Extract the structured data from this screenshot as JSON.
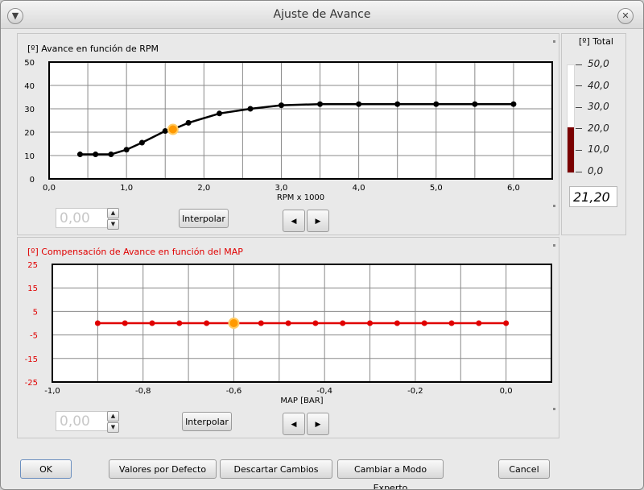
{
  "window": {
    "title": "Ajuste de Avance"
  },
  "rpm_panel": {
    "title": "[º] Avance en función de RPM",
    "input_value": "0,00",
    "interpolate_label": "Interpolar"
  },
  "map_panel": {
    "title": "[º] Compensación de Avance en función del MAP",
    "input_value": "0,00",
    "interpolate_label": "Interpolar"
  },
  "total": {
    "title": "[º] Total",
    "scale_labels": [
      "50,0",
      "40,0",
      "30,0",
      "20,0",
      "10,0",
      "0,0"
    ],
    "value": 21.2,
    "readout": "21,20"
  },
  "buttons": {
    "ok": "OK",
    "defaults": "Valores por Defecto",
    "discard": "Descartar Cambios",
    "expert": "Cambiar a Modo Experto",
    "cancel": "Cancel"
  },
  "colors": {
    "rpm_line": "#000000",
    "map_line": "#e00000",
    "map_text": "#e00000",
    "selected_point": "#ff9900",
    "thermometer_fill": "#7a0000"
  },
  "chart_data": [
    {
      "type": "line",
      "title": "[º] Avance en función de RPM",
      "xlabel": "RPM x 1000",
      "ylabel": "",
      "xlim": [
        0,
        6.5
      ],
      "ylim": [
        0,
        50
      ],
      "xticks": [
        "0,0",
        "1,0",
        "2,0",
        "3,0",
        "4,0",
        "5,0",
        "6,0"
      ],
      "yticks": [
        "0",
        "10",
        "20",
        "30",
        "40",
        "50"
      ],
      "grid": true,
      "series": [
        {
          "x": [
            0.4,
            0.6,
            0.8,
            1.0,
            1.2,
            1.5,
            1.6,
            1.8,
            2.2,
            2.6,
            3.0,
            3.5,
            4.0,
            4.5,
            5.0,
            5.5,
            6.0
          ],
          "values": [
            10.5,
            10.5,
            10.5,
            12.5,
            15.5,
            20.5,
            21.2,
            24.0,
            28.0,
            30.0,
            31.5,
            32.0,
            32.0,
            32.0,
            32.0,
            32.0,
            32.0
          ]
        }
      ],
      "selected_index": 6
    },
    {
      "type": "line",
      "title": "[º] Compensación de Avance en función del MAP",
      "xlabel": "MAP [BAR]",
      "ylabel": "",
      "xlim": [
        -1.0,
        0.1
      ],
      "ylim": [
        -25,
        25
      ],
      "xticks": [
        "-1,0",
        "-0,8",
        "-0,6",
        "-0,4",
        "-0,2",
        "0,0"
      ],
      "yticks": [
        "25",
        "15",
        "5",
        "-5",
        "-15",
        "-25"
      ],
      "grid": true,
      "series": [
        {
          "x": [
            -0.9,
            -0.84,
            -0.78,
            -0.72,
            -0.66,
            -0.6,
            -0.54,
            -0.48,
            -0.42,
            -0.36,
            -0.3,
            -0.24,
            -0.18,
            -0.12,
            -0.06,
            0.0
          ],
          "values": [
            0,
            0,
            0,
            0,
            0,
            0,
            0,
            0,
            0,
            0,
            0,
            0,
            0,
            0,
            0,
            0
          ]
        }
      ],
      "selected_index": 5
    }
  ]
}
